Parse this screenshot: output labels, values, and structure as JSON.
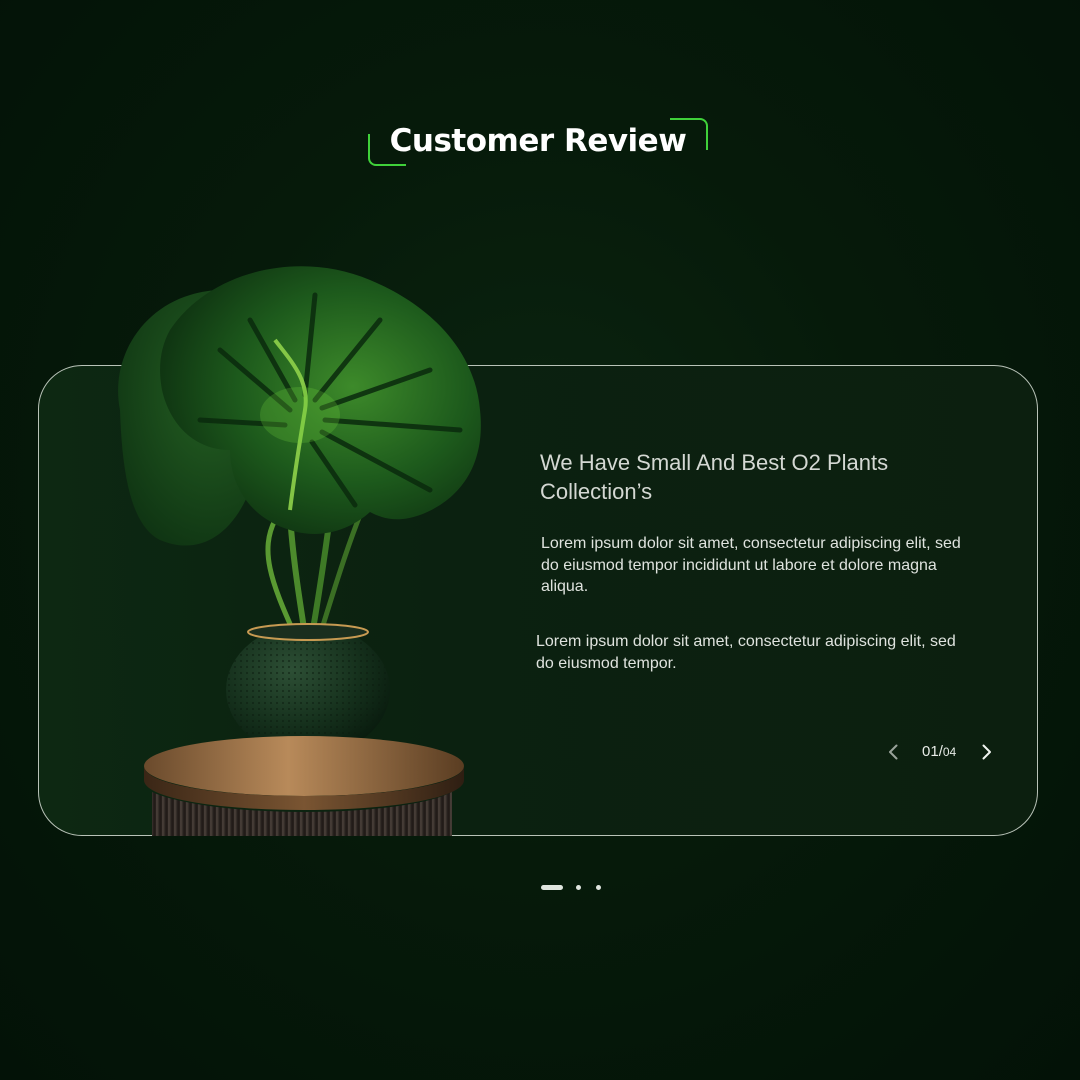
{
  "section": {
    "title": "Customer Review"
  },
  "card": {
    "title": "We Have Small And Best O2 Plants Collection’s",
    "paragraph_1": "Lorem ipsum dolor sit amet, consectetur adipiscing elit, sed do eiusmod tempor incididunt ut labore et dolore magna aliqua.",
    "paragraph_2": "Lorem ipsum dolor sit amet, consectetur adipiscing elit, sed do eiusmod tempor."
  },
  "pager": {
    "current": "01",
    "separator": "/",
    "total": "04",
    "prev_icon": "chevron-left-icon",
    "next_icon": "chevron-right-icon"
  },
  "dots": {
    "count": 3,
    "active_index": 0
  },
  "colors": {
    "background": "#031407",
    "accent": "#3fd13a",
    "card_border": "#b9c3b8",
    "text": "#dfe3de"
  }
}
